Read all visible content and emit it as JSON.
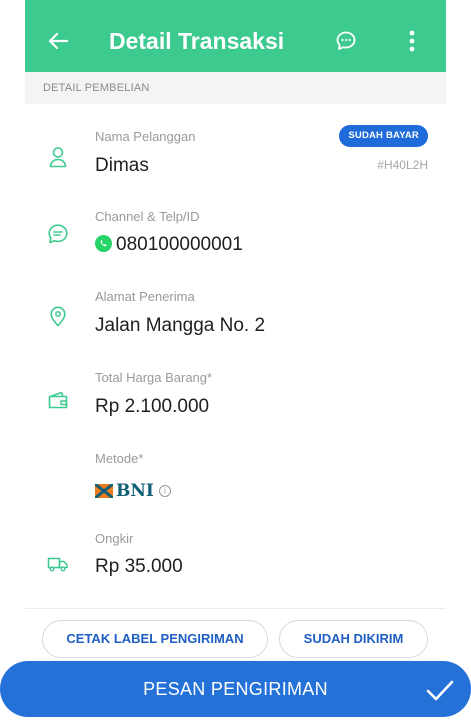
{
  "header": {
    "title": "Detail Transaksi",
    "bg_color": "#3dca8f"
  },
  "section": {
    "title": "DETAIL PEMBELIAN"
  },
  "customer": {
    "label": "Nama Pelanggan",
    "value": "Dimas",
    "status_badge": "SUDAH BAYAR",
    "transaction_id": "#H40L2H"
  },
  "channel": {
    "label": "Channel & Telp/ID",
    "value": "080100000001",
    "channel_icon": "whatsapp-icon"
  },
  "address": {
    "label": "Alamat Penerima",
    "value": "Jalan Mangga No. 2"
  },
  "total": {
    "label": "Total Harga Barang*",
    "value": "Rp 2.100.000"
  },
  "method": {
    "label": "Metode*",
    "bank": "BNI",
    "info_symbol": "i"
  },
  "shipping": {
    "label": "Ongkir",
    "value": "Rp 35.000"
  },
  "actions": {
    "print_label": "CETAK LABEL PENGIRIMAN",
    "shipped": "SUDAH DIKIRIM",
    "order_shipping": "PESAN PENGIRIMAN"
  },
  "colors": {
    "accent_green": "#3dca8f",
    "primary_blue": "#2471d8",
    "badge_blue": "#1f6bd9"
  }
}
